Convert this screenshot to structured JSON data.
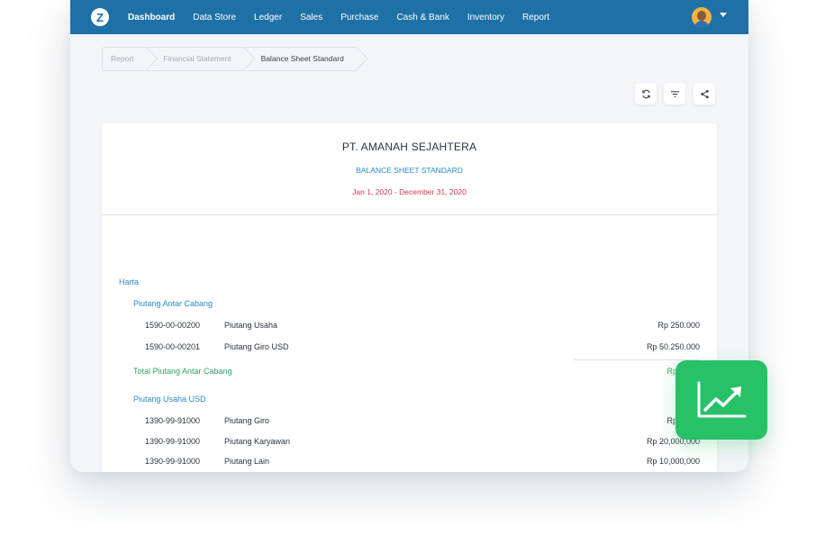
{
  "topbar": {
    "logo": "Z",
    "nav": [
      "Dashboard",
      "Data Store",
      "Ledger",
      "Sales",
      "Purchase",
      "Cash & Bank",
      "Inventory",
      "Report"
    ]
  },
  "breadcrumb": [
    "Report",
    "Financial Statement",
    "Balance Sheet Standard"
  ],
  "toolbar": {
    "icons": [
      "refresh-icon",
      "filter-icon",
      "share-icon"
    ]
  },
  "report": {
    "company": "PT. AMANAH SEJAHTERA",
    "title": "BALANCE SHEET STANDARD",
    "period": "Jan 1, 2020 - December 31, 2020",
    "section": "Harta",
    "groups": [
      {
        "name": "Piutang Antar Cabang",
        "rows": [
          {
            "code": "1590-00-00200",
            "name": "Piutang Usaha",
            "amount": "Rp 250.000"
          },
          {
            "code": "1590-00-00201",
            "name": "Piutang Giro USD",
            "amount": "Rp 50.250.000"
          }
        ],
        "total_label": "Total Piutang Antar Cabang",
        "total_amount": "Rp 50.50"
      },
      {
        "name": "Piutang Usaha USD",
        "rows": [
          {
            "code": "1390-99-91000",
            "name": "Piutang Giro",
            "amount": "Rp 10,00"
          },
          {
            "code": "1390-99-91000",
            "name": "Piutang Karyawan",
            "amount": "Rp 20,000,000"
          },
          {
            "code": "1390-99-91000",
            "name": "Piutang Lain",
            "amount": "Rp 10,000,000"
          }
        ]
      }
    ]
  },
  "colors": {
    "brand": "#1e71a6",
    "title_blue": "#2c8bc6",
    "period_red": "#d3384f",
    "total_green": "#34a466",
    "fab_green": "#27c168"
  },
  "fab": {
    "icon": "trending-up-chart-icon"
  }
}
